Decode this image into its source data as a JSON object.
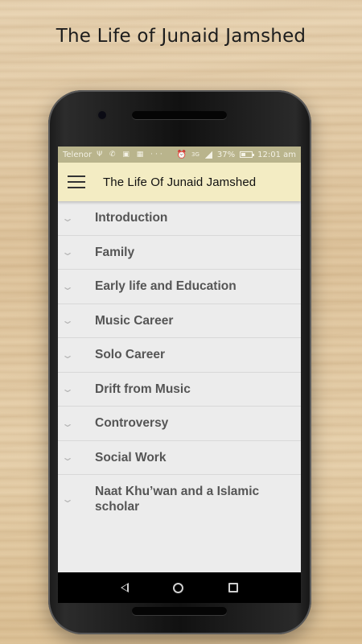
{
  "promo": {
    "headline": "The Life of Junaid Jamshed"
  },
  "status_bar": {
    "carrier": "Telenor",
    "notifications": "Ψ ✆ ▣ ▦ ···",
    "network": "3G",
    "battery": "37%",
    "time": "12:01 am",
    "color": "#b9b48c"
  },
  "toolbar": {
    "title": "The Life Of Junaid Jamshed",
    "menu_icon": "hamburger-menu-icon",
    "color": "#f3ecc3"
  },
  "chapters": [
    {
      "label": "Introduction"
    },
    {
      "label": "Family"
    },
    {
      "label": "Early life and Education"
    },
    {
      "label": "Music Career"
    },
    {
      "label": "Solo Career"
    },
    {
      "label": "Drift from Music"
    },
    {
      "label": "Controversy"
    },
    {
      "label": "Social Work"
    },
    {
      "label": "Naat Khu’wan and a Islamic scholar"
    }
  ],
  "nav_bar": {
    "icons": [
      "back-icon",
      "home-icon",
      "recents-icon"
    ]
  }
}
